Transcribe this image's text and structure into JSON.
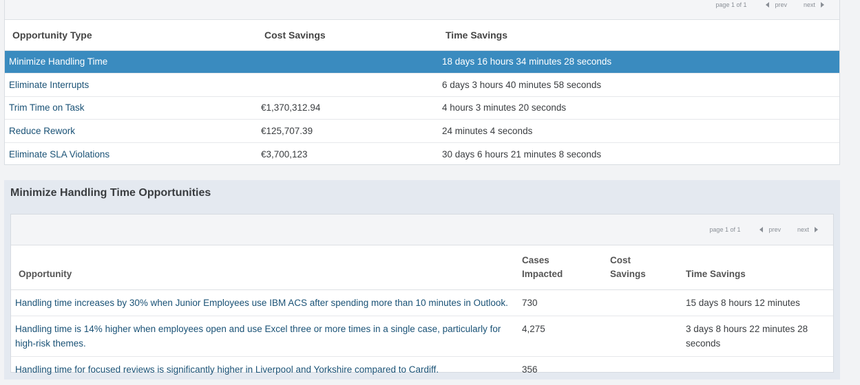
{
  "top": {
    "pager": {
      "info": "page 1 of 1",
      "prev": "prev",
      "next": "next"
    },
    "headers": {
      "type": "Opportunity Type",
      "cost": "Cost Savings",
      "time": "Time Savings"
    },
    "rows": [
      {
        "type": "Minimize Handling Time",
        "cost": "",
        "time": "18 days 16 hours 34 minutes 28 seconds",
        "selected": true
      },
      {
        "type": "Eliminate Interrupts",
        "cost": "",
        "time": "6 days 3 hours 40 minutes 58 seconds"
      },
      {
        "type": "Trim Time on Task",
        "cost": "€1,370,312.94",
        "time": "4 hours 3 minutes 20 seconds"
      },
      {
        "type": "Reduce Rework",
        "cost": "€125,707.39",
        "time": "24 minutes 4 seconds"
      },
      {
        "type": "Eliminate SLA Violations",
        "cost": "€3,700,123",
        "time": "30 days 6 hours 21 minutes 8 seconds"
      }
    ]
  },
  "bottom": {
    "title": "Minimize Handling Time Opportunities",
    "pager": {
      "info": "page 1 of 1",
      "prev": "prev",
      "next": "next"
    },
    "headers": {
      "opportunity": "Opportunity",
      "cases_line1": "Cases",
      "cases_line2": "Impacted",
      "cost_line1": "Cost",
      "cost_line2": "Savings",
      "time": "Time Savings"
    },
    "rows": [
      {
        "opportunity": "Handling time increases by 30% when Junior Employees use IBM ACS after spending more than 10 minutes in Outlook.",
        "cases": "730",
        "cost": "",
        "time": "15 days 8 hours 12 minutes"
      },
      {
        "opportunity": "Handling time is 14% higher when employees open and use Excel three or more times in a single case, particularly for high-risk themes.",
        "cases": "4,275",
        "cost": "",
        "time": "3 days 8 hours 22 minutes 28 seconds"
      },
      {
        "opportunity": "Handling time for focused reviews is significantly higher in Liverpool and Yorkshire compared to Cardiff.",
        "cases": "356",
        "cost": "",
        "time": ""
      }
    ]
  }
}
